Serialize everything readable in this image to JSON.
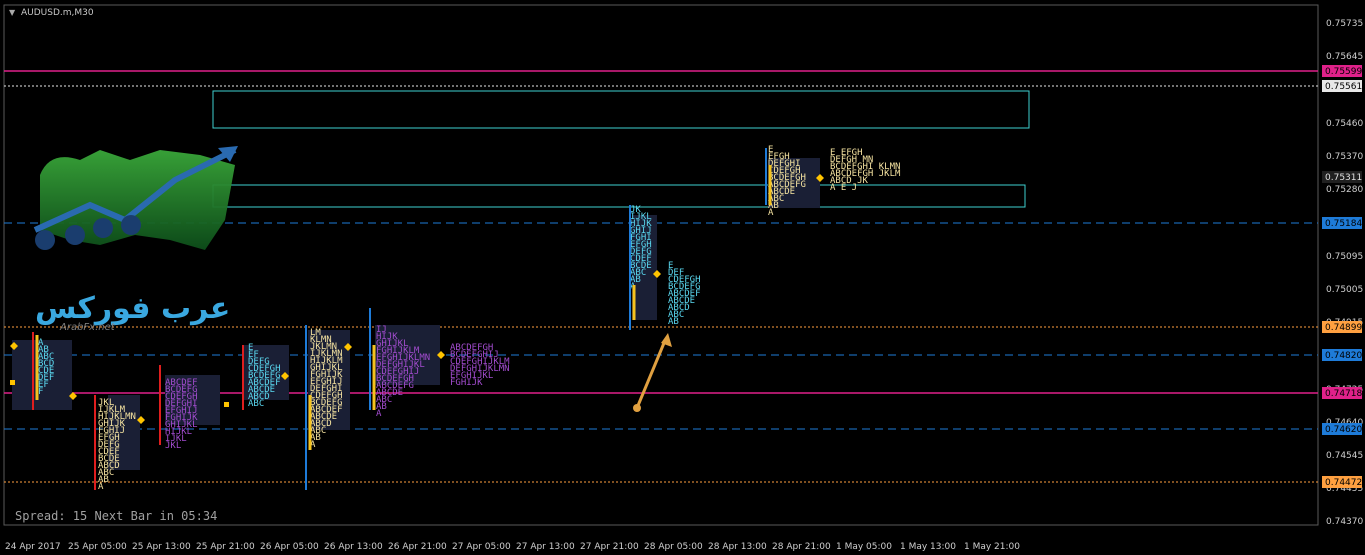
{
  "window": {
    "title": "AUDUSD.m,M30",
    "status": "Spread: 15 Next Bar in 05:34",
    "watermark": "ArabFx.net",
    "logo_text": "عرب فوركس"
  },
  "price_axis": {
    "ticks": [
      "0.75735",
      "0.75645",
      "0.75460",
      "0.75370",
      "0.75280",
      "0.75095",
      "0.75005",
      "0.74915",
      "0.74725",
      "0.74640",
      "0.74545",
      "0.74455",
      "0.74370"
    ]
  },
  "time_axis": {
    "labels": [
      "24 Apr 2017",
      "25 Apr 05:00",
      "25 Apr 13:00",
      "25 Apr 21:00",
      "26 Apr 05:00",
      "26 Apr 13:00",
      "26 Apr 21:00",
      "27 Apr 05:00",
      "27 Apr 13:00",
      "27 Apr 21:00",
      "28 Apr 05:00",
      "28 Apr 13:00",
      "28 Apr 21:00",
      "1 May 05:00",
      "1 May 13:00",
      "1 May 21:00"
    ]
  },
  "levels": [
    {
      "price": "0.75599",
      "style": "solid",
      "color": "#e0218a"
    },
    {
      "price": "0.75561",
      "style": "dotted",
      "color": "#e8e8e8"
    },
    {
      "price": "0.75311",
      "style": "none",
      "color": "#202020"
    },
    {
      "price": "0.75184",
      "style": "dashed",
      "color": "#1e7bd8"
    },
    {
      "price": "0.74899",
      "style": "dotted",
      "color": "#ffa040"
    },
    {
      "price": "0.74820",
      "style": "dashed",
      "color": "#1e7bd8"
    },
    {
      "price": "0.74718",
      "style": "solid",
      "color": "#e0218a"
    },
    {
      "price": "0.74620",
      "style": "dashed",
      "color": "#1e7bd8"
    },
    {
      "price": "0.74472",
      "style": "dotted",
      "color": "#ffa040"
    }
  ],
  "tpo_text": {
    "b1": "A\nAB\nABC\nBCD\nCDE\nDEF\nEF\nF",
    "b2": "JKL\nIJKLM\nHIJKLMN\nGHIJK\nFGHIJ\nEFGH\nDEFG\nCDEF\nBCDE\nABCD\nABC\nAB\nA",
    "b3": "ABCDEF\nBCDEFG\nCDEFGH\nDEFGHI\nEFGHIJ\nFGHIJK\nGHIJKL\nHIJKL\nIJKL\nJKL",
    "b4": "E\nEF\nDEFG\nCDEFGH\nBCDEFG\nABCDEF\nABCDE\nABCD\nABC",
    "b5": "LM\nKLMN\nJKLMN\nIJKLMN\nHIJKLM\nGHIJKL\nFGHIJK\nEFGHIJ\nDEFGHI\nCDEFGH\nBCDEFG\nABCDEF\nABCDE\nABCD\nABC\nAB\nA",
    "b6": "IJ\nHIJK\nGHIJKL\nFGHIJKLM\nEFGHIJKLMN\nDEFGHIJKL\nCDEFGHIJ\nBCDEFGH\nABCDEFG\nABCDE\nABC\nAB\nA",
    "b7": "ABCDEFGH\nBCDEFGHIJ\nCDEFGHIJKLM\nDEFGHIJKLMN\nEFGHIJKL\nFGHIJK",
    "b8": "JK\nIJKL\nHIJK\nGHIJ\nFGHI\nEFGH\nDEFG\nCDEF\nBCDE\nABC\nAB\nA",
    "b9": "E\nDEF\nCDEFGH\nBCDEFG\nABCDEF\nABCDE\nABCD\nABC\nAB",
    "b10": "E\nEFGH\nDEFGHI\nCDEFGH\nBCDEFGH\nABCDEFG\nABCDE\nABC\nAB\nA",
    "b11": "E  EFGH\nDEFGH  MN\nBCDEFGHI  KLMN\nABCDEFGH   JKLM\nABCD  JK\nA  E  J"
  }
}
